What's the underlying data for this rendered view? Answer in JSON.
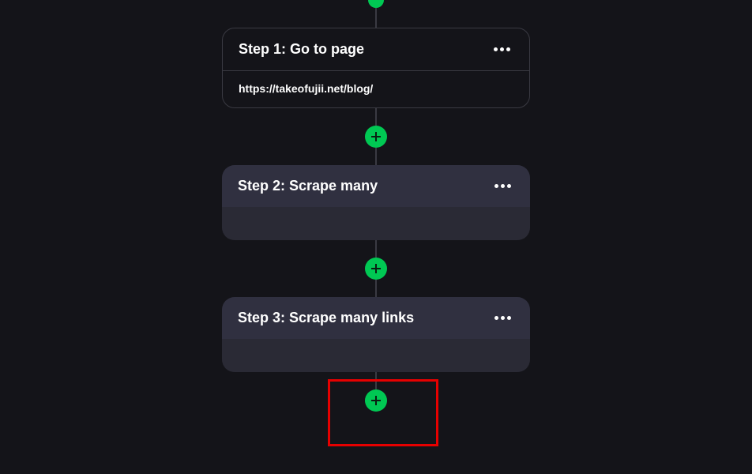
{
  "workflow": {
    "steps": [
      {
        "title": "Step 1: Go to page",
        "url": "https://takeofujii.net/blog/"
      },
      {
        "title": "Step 2: Scrape many"
      },
      {
        "title": "Step 3: Scrape many links"
      }
    ]
  },
  "colors": {
    "accent": "#00c853",
    "background": "#141419",
    "cardBg": "#2a2a35",
    "cardHeader": "#303040",
    "highlight": "#e60000"
  }
}
